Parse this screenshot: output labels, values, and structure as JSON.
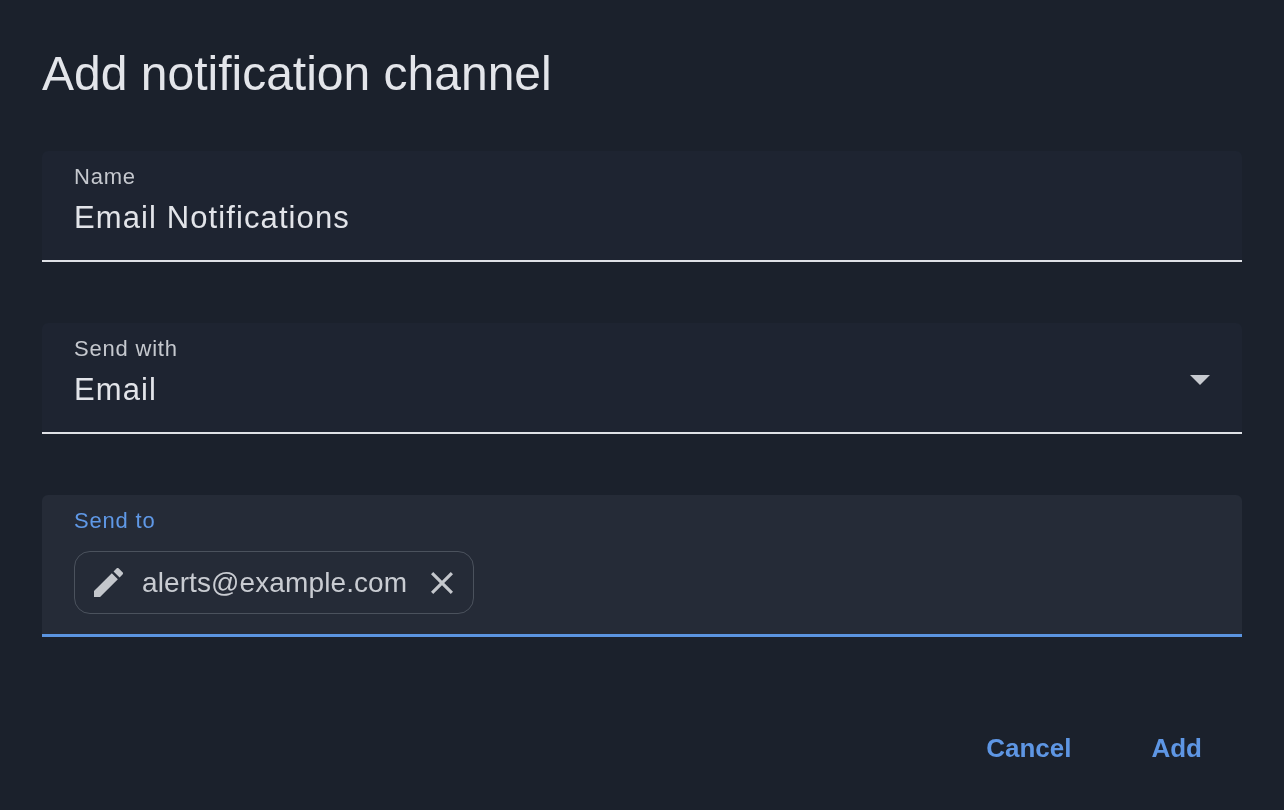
{
  "dialog": {
    "title": "Add notification channel"
  },
  "fields": [
    {
      "kind": "text",
      "label": "Name",
      "value": "Email Notifications",
      "focused": false
    },
    {
      "kind": "select",
      "label": "Send with",
      "value": "Email",
      "focused": false
    },
    {
      "kind": "chips",
      "label": "Send to",
      "focused": true,
      "chips": [
        {
          "text": "alerts@example.com"
        }
      ]
    }
  ],
  "buttons": [
    "Cancel",
    "Add"
  ]
}
